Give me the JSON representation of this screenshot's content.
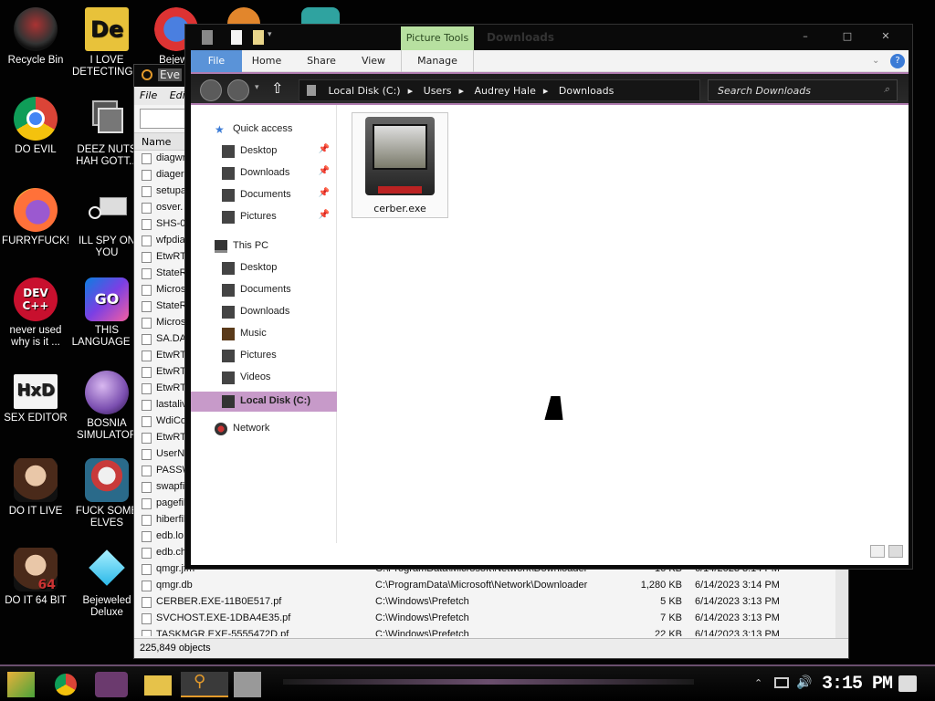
{
  "desktop": {
    "icons": [
      {
        "label": "Recycle Bin"
      },
      {
        "label": "I LOVE DETECTING..."
      },
      {
        "label": "Bejewe"
      },
      {
        "label": "DO EVIL"
      },
      {
        "label": "DEEZ NUTS HAH GOTT..."
      },
      {
        "label": "FURRYFUCK!"
      },
      {
        "label": "ILL SPY ON YOU"
      },
      {
        "label": "never used why is it ..."
      },
      {
        "label": "THIS LANGUAGE ..."
      },
      {
        "label": "SEX EDITOR"
      },
      {
        "label": "BOSNIA SIMULATOR"
      },
      {
        "label": "DO IT LIVE"
      },
      {
        "label": "FUCK SOME ELVES"
      },
      {
        "label": "DO IT 64 BIT"
      },
      {
        "label": "Bejeweled Deluxe"
      }
    ]
  },
  "everything": {
    "title": "Eve",
    "menu": [
      "File",
      "Edi"
    ],
    "col_name": "Name",
    "rows_left": [
      "diagwr",
      "diagerr",
      "setupa",
      "osver.",
      "SHS-0",
      "wfpdia",
      "EtwRT",
      "StateR",
      "Micros",
      "StateR",
      "Micros",
      "SA.DA",
      "EtwRT",
      "EtwRT",
      "EtwRT",
      "lastaliv",
      "WdiCor",
      "EtwRT",
      "UserNo",
      "PASSW",
      "swapfi",
      "pagefil",
      "hiberfil",
      "edb.lo",
      "edb.ch"
    ],
    "rows_full": [
      {
        "name": "qmgr.jfm",
        "path": "C:\\ProgramData\\Microsoft\\Network\\Downloader",
        "size": "16 KB",
        "date": "6/14/2023 3:14 PM"
      },
      {
        "name": "qmgr.db",
        "path": "C:\\ProgramData\\Microsoft\\Network\\Downloader",
        "size": "1,280 KB",
        "date": "6/14/2023 3:14 PM"
      },
      {
        "name": "CERBER.EXE-11B0E517.pf",
        "path": "C:\\Windows\\Prefetch",
        "size": "5 KB",
        "date": "6/14/2023 3:13 PM"
      },
      {
        "name": "SVCHOST.EXE-1DBA4E35.pf",
        "path": "C:\\Windows\\Prefetch",
        "size": "7 KB",
        "date": "6/14/2023 3:13 PM"
      },
      {
        "name": "TASKMGR.EXE-5555472D.pf",
        "path": "C:\\Windows\\Prefetch",
        "size": "22 KB",
        "date": "6/14/2023 3:13 PM"
      }
    ],
    "status": "225,849 objects"
  },
  "explorer": {
    "title": "Downloads",
    "context_tab": "Picture Tools",
    "ribbon_tabs": {
      "file": "File",
      "home": "Home",
      "share": "Share",
      "view": "View",
      "manage": "Manage"
    },
    "window_buttons": {
      "minimize": "–",
      "maximize": "□",
      "close": "✕"
    },
    "breadcrumb": [
      "Local Disk (C:)",
      "Users",
      "Audrey Hale",
      "Downloads"
    ],
    "search_placeholder": "Search Downloads",
    "nav": {
      "quick_access": "Quick access",
      "qa_items": [
        "Desktop",
        "Downloads",
        "Documents",
        "Pictures"
      ],
      "this_pc": "This PC",
      "pc_items": [
        "Desktop",
        "Documents",
        "Downloads",
        "Music",
        "Pictures",
        "Videos"
      ],
      "local_disk": "Local Disk (C:)",
      "network": "Network"
    },
    "files": [
      {
        "name": "cerber.exe"
      }
    ]
  },
  "taskbar": {
    "clock": "3:15 PM"
  },
  "colors": {
    "accent": "#c79ac9",
    "picture_tools": "#b7e0a0",
    "file_tab": "#5a93d8"
  }
}
